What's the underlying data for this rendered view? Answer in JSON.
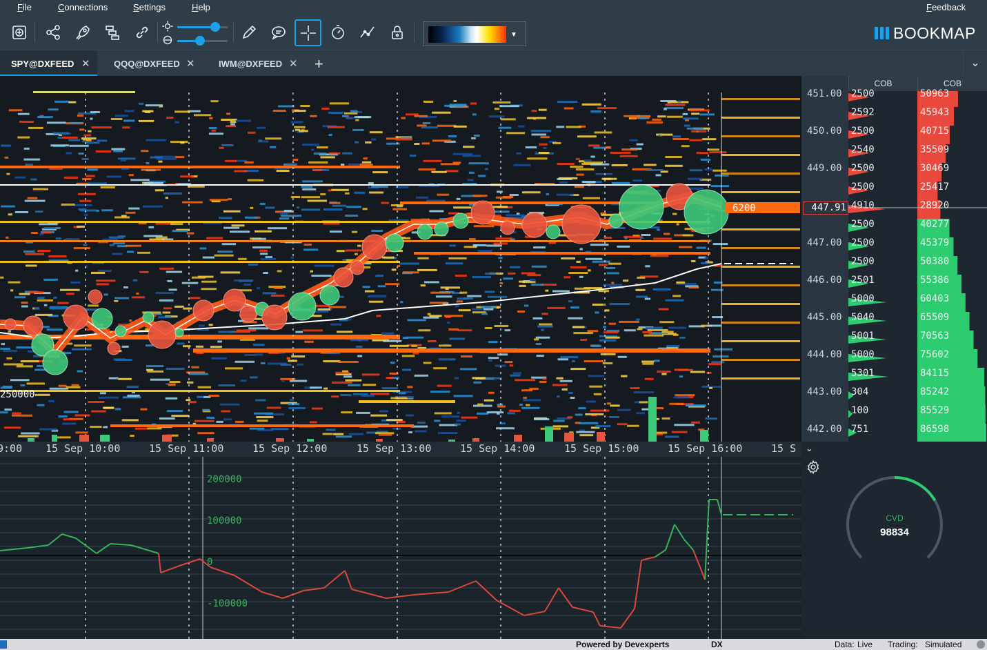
{
  "menu": {
    "items": [
      "File",
      "Connections",
      "Settings",
      "Help"
    ],
    "feedback": "Feedback"
  },
  "toolbar": {
    "icons": [
      "zoom-in-icon",
      "share-icon",
      "rocket-icon",
      "layers-icon",
      "link-icon",
      "brightness-icon",
      "contrast-icon",
      "pencil-icon",
      "chat-icon",
      "crosshair-icon",
      "stopwatch-icon",
      "indicator-icon",
      "lock-icon"
    ],
    "brightness_level": 0.75,
    "contrast_level": 0.45,
    "colormap_label": "heatmap color palette"
  },
  "logo": {
    "text": "BOOKMAP"
  },
  "tabs": [
    {
      "label": "SPY@DXFEED",
      "active": true
    },
    {
      "label": "QQQ@DXFEED",
      "active": false
    },
    {
      "label": "IWM@DXFEED",
      "active": false
    }
  ],
  "heatmap": {
    "left_label": "250000",
    "marker_label": "6200",
    "time_labels": [
      "9:00",
      "15 Sep 10:00",
      "15 Sep 11:00",
      "15 Sep 12:00",
      "15 Sep 13:00",
      "15 Sep 14:00",
      "15 Sep 15:00",
      "15 Sep 16:00",
      "15 S"
    ]
  },
  "price_axis": {
    "labels": [
      "451.00",
      "450.00",
      "449.00",
      "447.00",
      "446.00",
      "445.00",
      "444.00",
      "443.00",
      "442.00"
    ],
    "current_price": "447.91"
  },
  "cob": {
    "header1": "COB",
    "header2": "COB",
    "col1_values": [
      "2500",
      "2592",
      "2500",
      "2540",
      "2500",
      "2500",
      "4910",
      "2500",
      "2500",
      "2500",
      "2501",
      "5000",
      "5040",
      "5001",
      "5000",
      "5301",
      "304",
      "100",
      "751"
    ],
    "col2_values": [
      "50963",
      "45943",
      "40715",
      "35509",
      "30469",
      "25417",
      "28920",
      "40277",
      "45379",
      "50380",
      "55386",
      "60403",
      "65509",
      "70563",
      "75602",
      "84115",
      "85242",
      "85529",
      "86598"
    ]
  },
  "indicator": {
    "axis_labels": [
      "200000",
      "100000",
      "0",
      "-100000"
    ]
  },
  "cvd": {
    "label": "CVD",
    "value": "98834",
    "fill_fraction": 0.22
  },
  "status": {
    "powered": "Powered by Devexperts",
    "dx": "DX",
    "data_label": "Data:",
    "data_value": "Live",
    "trading_label": "Trading:",
    "trading_value": "Simulated"
  },
  "colors": {
    "accent": "#1f9fe8",
    "bid": "#2ecc71",
    "ask": "#e74c3c",
    "panel": "#2f3d49"
  }
}
